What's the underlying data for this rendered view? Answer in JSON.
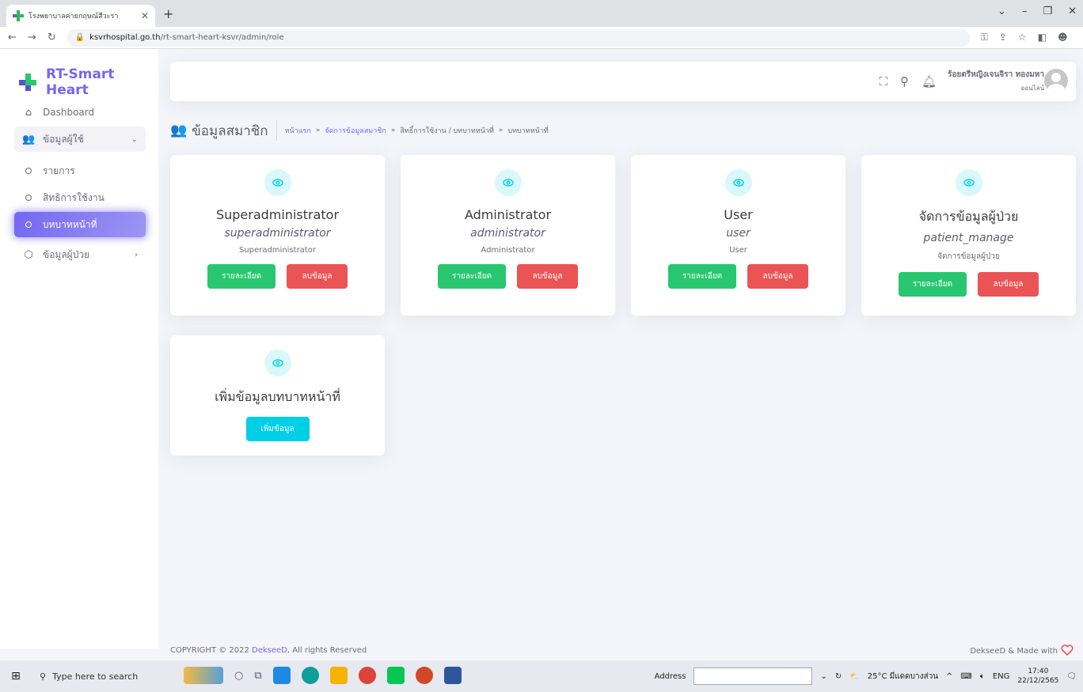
{
  "browser": {
    "tab_title": "โรงพยาบาลค่ายกฤษณ์สีวะรา",
    "url_host": "ksvrhospital.go.th",
    "url_path": "/rt-smart-heart-ksvr/admin/role"
  },
  "sidebar": {
    "brand": "RT-Smart Heart",
    "items": [
      {
        "label": "Dashboard"
      },
      {
        "label": "ข้อมูลผู้ใช้"
      },
      {
        "label": "รายการ"
      },
      {
        "label": "สิทธิการใช้งาน"
      },
      {
        "label": "บทบาทหน้าที่"
      },
      {
        "label": "ข้อมูลผู้ป่วย"
      }
    ]
  },
  "navbar": {
    "user_name": "ร้อยตรีหญิงเจนจิรา ทองมหา",
    "user_status": "ออนไลน์"
  },
  "page": {
    "title": "ข้อมูลสมาชิก",
    "breadcrumb": {
      "home": "หน้าแรก",
      "manage": "จัดการข้อมูลสมาชิก",
      "perm": "สิทธิ์การใช้งาน / บทบาทหน้าที่",
      "current": "บทบาทหน้าที่"
    }
  },
  "cards": [
    {
      "title": "Superadministrator",
      "code": "superadministrator",
      "desc": "Superadministrator",
      "detail_label": "รายละเอียด",
      "delete_label": "ลบข้อมูล"
    },
    {
      "title": "Administrator",
      "code": "administrator",
      "desc": "Administrator",
      "detail_label": "รายละเอียด",
      "delete_label": "ลบข้อมูล"
    },
    {
      "title": "User",
      "code": "user",
      "desc": "User",
      "detail_label": "รายละเอียด",
      "delete_label": "ลบข้อมูล"
    },
    {
      "title": "จัดการข้อมูลผู้ป่วย",
      "code": "patient_manage",
      "desc": "จัดการข้อมูลผู้ป่วย",
      "detail_label": "รายละเอียด",
      "delete_label": "ลบข้อมูล"
    }
  ],
  "add_card": {
    "title": "เพิ่มข้อมูลบทบาทหน้าที่",
    "button_label": "เพิ่มข้อมูล"
  },
  "footer": {
    "copyright_prefix": "COPYRIGHT © 2022 ",
    "company": "DekseeD",
    "copyright_suffix": ", All rights Reserved",
    "made_with": "DekseeD & Made with"
  },
  "taskbar": {
    "search_placeholder": "Type here to search",
    "address_label": "Address",
    "weather": "25°C มีแดดบางส่วน",
    "lang": "ENG",
    "time": "17:40",
    "date": "22/12/2565"
  },
  "colors": {
    "primary": "#7367f0",
    "success": "#28c76f",
    "danger": "#ea5455",
    "info": "#00cfe8"
  }
}
